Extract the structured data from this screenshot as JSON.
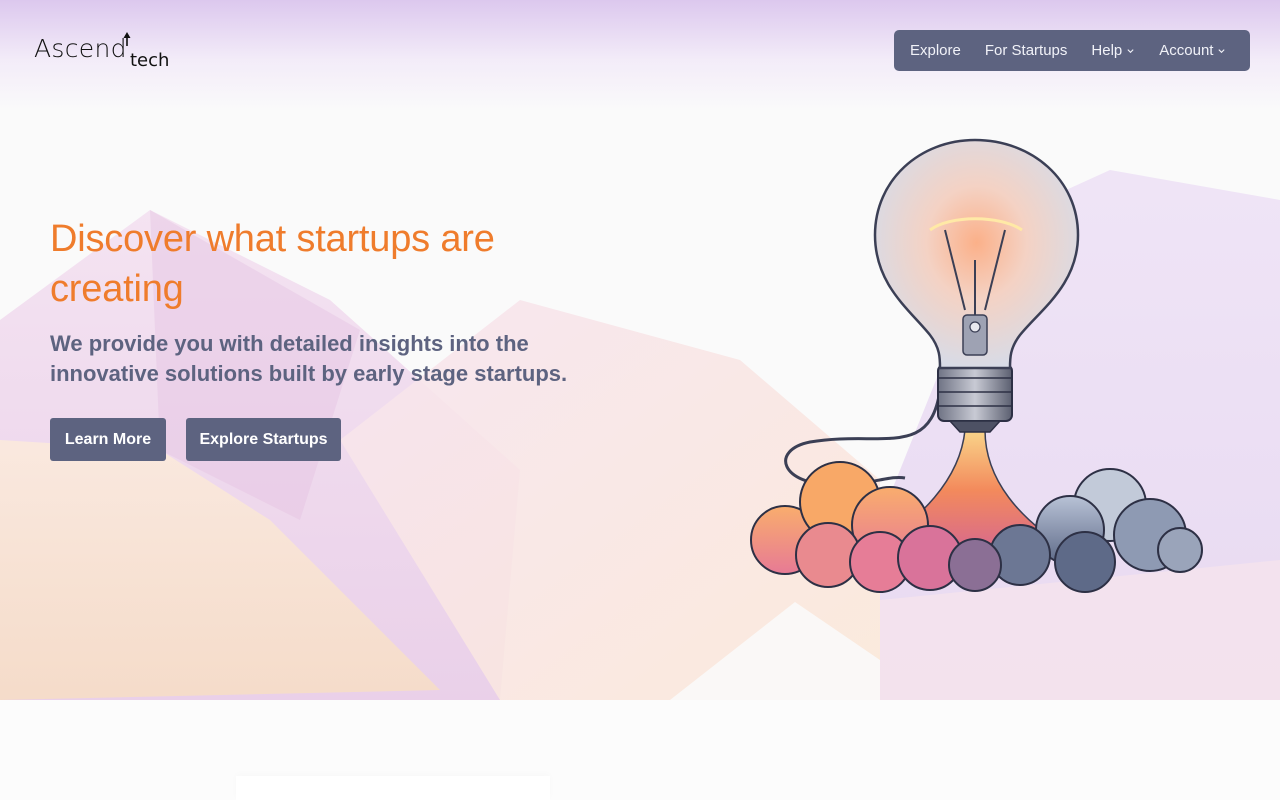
{
  "brand": {
    "name": "Ascend",
    "suffix": "tech"
  },
  "nav": {
    "items": [
      {
        "label": "Explore",
        "has_dropdown": false
      },
      {
        "label": "For Startups",
        "has_dropdown": false
      },
      {
        "label": "Help",
        "has_dropdown": true
      },
      {
        "label": "Account",
        "has_dropdown": true
      }
    ]
  },
  "hero": {
    "headline": "Discover what startups are creating",
    "subhead": "We provide you with detailed insights into the innovative solutions built by early stage startups.",
    "buttons": {
      "learn_more": "Learn More",
      "explore_startups": "Explore Startups"
    },
    "illustration_icon": "lightbulb-rocket-icon"
  },
  "colors": {
    "accent": "#ef7c2c",
    "primary": "#5d6380",
    "nav_text": "#f1f2f8",
    "tint": "#dcc8ee"
  }
}
